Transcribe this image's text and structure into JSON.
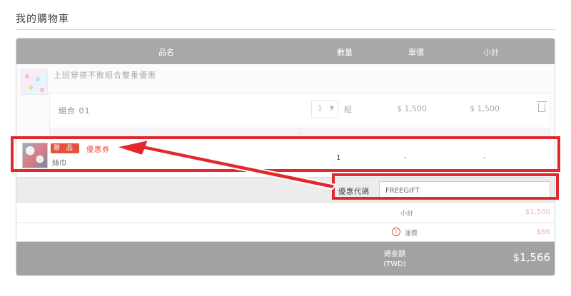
{
  "page": {
    "title": "我的購物車"
  },
  "table": {
    "headers": {
      "name": "品名",
      "qty": "數量",
      "unit_price": "單價",
      "subtotal": "小計"
    }
  },
  "bundle": {
    "title": "上班穿搭不敗組合雙重優惠",
    "combo": {
      "label": "組合 01",
      "qty": "1",
      "unit": "組",
      "price": "$ 1,500",
      "subtotal": "$ 1,500"
    }
  },
  "gift": {
    "badge": "贈 品",
    "coupon_label": "優惠券",
    "name": "絲巾",
    "qty": "1",
    "price": "-",
    "subtotal": "-"
  },
  "coupon": {
    "label": "優惠代碼",
    "value": "FREEGIFT"
  },
  "summary": {
    "subtotal_label": "小計",
    "subtotal_value": "$1,500",
    "shipping_label": "運費",
    "shipping_info": "i",
    "shipping_value": "$66",
    "total_label": "總金額",
    "total_currency": "(TWD)",
    "total_value": "$1,566"
  },
  "icons": {
    "qty_caret": "▼",
    "expand": "⌄",
    "trash": "trash-icon"
  },
  "colors": {
    "accent": "#e2533d",
    "callout": "#e2282d",
    "header_bg": "#a8a8a8"
  }
}
